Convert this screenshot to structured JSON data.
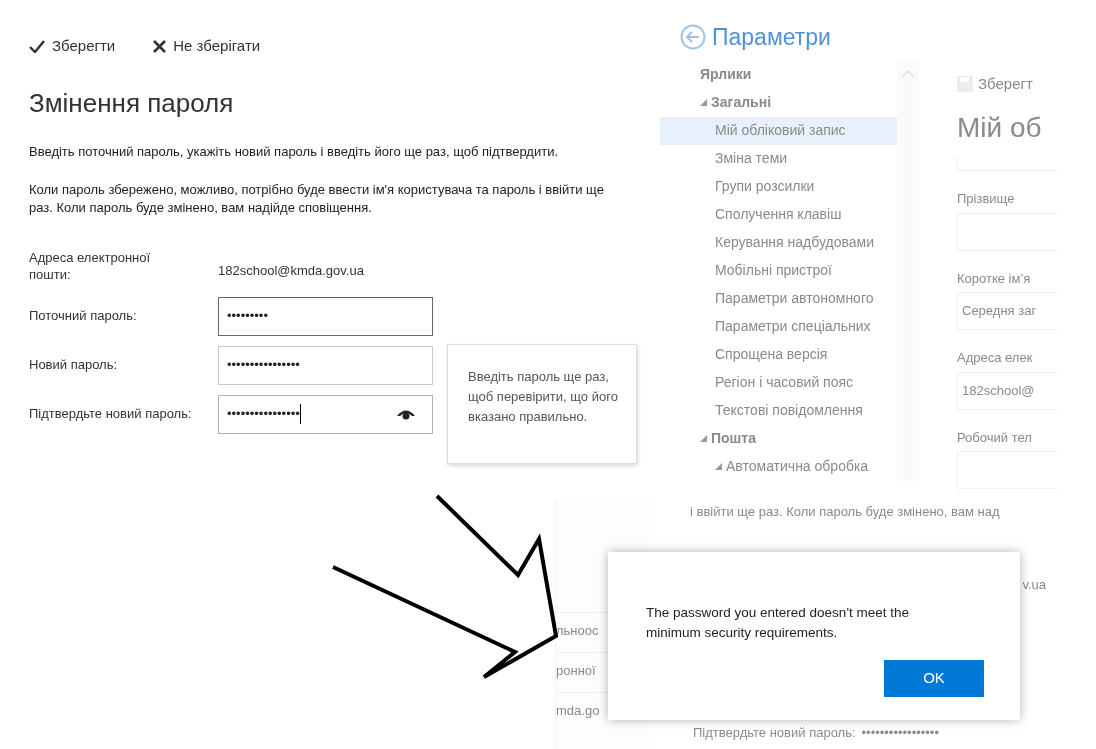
{
  "toolbar": [
    {
      "kind": "check",
      "label": "Зберегти"
    },
    {
      "kind": "cross",
      "label": "Не зберігати"
    }
  ],
  "title": "Змінення пароля",
  "paragraphs": [
    "Введіть поточний пароль, укажіть новий пароль і введіть його ще раз, щоб підтвердити.",
    "Коли пароль збережено, можливо, потрібно буде ввести ім'я користувача та пароль і ввійти ще раз. Коли пароль буде змінено, вам надійде сповіщення."
  ],
  "form": {
    "email_label": "Адреса електронної пошти:",
    "email": "182school@kmda.gov.ua",
    "fields": [
      {
        "label": "Поточний пароль:",
        "value": "•••••••••",
        "focused": false,
        "reveal": false
      },
      {
        "label": "Новий пароль:",
        "value": "••••••••••••••••",
        "focused": false,
        "reveal": false
      },
      {
        "label": "Підтвердьте новий пароль:",
        "value": "••••••••••••••••",
        "focused": true,
        "reveal": true
      }
    ]
  },
  "tooltip": "Введіть пароль ще раз, щоб перевірити, що його вказано правильно.",
  "settings": {
    "title": "Параметри",
    "tree": [
      {
        "label": "Ярлики"
      },
      {
        "label": "Загальні",
        "expanded": true,
        "children": [
          {
            "label": "Мій обліковий запис",
            "selected": true
          },
          {
            "label": "Зміна теми",
            "selected": false
          },
          {
            "label": "Групи розсилки",
            "selected": false
          },
          {
            "label": "Сполучення клавіш",
            "selected": false
          },
          {
            "label": "Керування надбудовами",
            "selected": false
          },
          {
            "label": "Мобільні пристрої",
            "selected": false
          },
          {
            "label": "Параметри автономного",
            "selected": false
          },
          {
            "label": "Параметри спеціальних",
            "selected": false
          },
          {
            "label": "Спрощена версія",
            "selected": false
          },
          {
            "label": "Регіон і часовий пояс",
            "selected": false
          },
          {
            "label": "Текстові повідомлення",
            "selected": false
          }
        ]
      },
      {
        "label": "Пошта",
        "expanded": true,
        "children": [
          {
            "label": "Автоматична обробка",
            "expanded": true,
            "selected": false
          }
        ]
      }
    ],
    "save": "Зберегт",
    "heading": "Мій об",
    "fields": [
      {
        "label": "Прізвище"
      },
      {
        "label": "Коротке ім’я",
        "value": "Середня заг"
      },
      {
        "label": "Адреса елек",
        "value": "182school@"
      },
      {
        "label": "Робочий тел"
      }
    ]
  },
  "fragment": {
    "text": "і ввійти ще раз. Коли пароль буде змінено, вам над",
    "email_tail": "v.ua",
    "confirm_label": "Підтвердьте новий пароль:",
    "confirm_value": "•••••••••••••••••",
    "side_texts": [
      "льноос",
      "ронної",
      "mda.go"
    ]
  },
  "dialog": {
    "message": "The password you entered doesn't meet the minimum security requirements.",
    "button": "OK"
  }
}
